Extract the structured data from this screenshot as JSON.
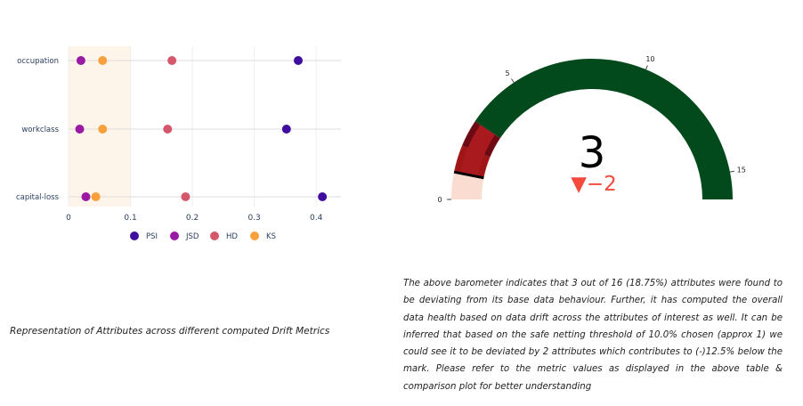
{
  "chart_data": [
    {
      "type": "scatter",
      "categories": [
        "occupation",
        "workclass",
        "capital-loss"
      ],
      "x_ticks": [
        0,
        0.1,
        0.2,
        0.3,
        0.4
      ],
      "x_tick_labels": [
        "0",
        "0.1",
        "0.2",
        "0.3",
        "0.4"
      ],
      "xlim": [
        0,
        0.44
      ],
      "threshold_band": [
        0,
        0.1
      ],
      "band_color": "#fdf4ea",
      "legend_position": "bottom",
      "series": [
        {
          "name": "PSI",
          "color": "#3f0ea0",
          "values": [
            0.371,
            0.352,
            0.41
          ]
        },
        {
          "name": "JSD",
          "color": "#9b1aa3",
          "values": [
            0.02,
            0.018,
            0.028
          ]
        },
        {
          "name": "HD",
          "color": "#d4576b",
          "values": [
            0.167,
            0.16,
            0.189
          ]
        },
        {
          "name": "KS",
          "color": "#f7a03c",
          "values": [
            0.055,
            0.055,
            0.044
          ]
        }
      ]
    },
    {
      "type": "gauge",
      "value": 3,
      "display_value": "3",
      "range": [
        0,
        16
      ],
      "ticks": [
        0,
        5,
        10,
        15
      ],
      "delta": -2,
      "delta_label": "▼−2",
      "bar_color": "#024a1c",
      "steps": [
        {
          "range": [
            0,
            1
          ],
          "color": "#fadcd0"
        },
        {
          "range": [
            1,
            2
          ],
          "color": "#a01616"
        },
        {
          "range": [
            2,
            3
          ],
          "color": "#6e0a14"
        }
      ],
      "bar_band": [
        1,
        3
      ],
      "bar_band_color": "#a81a1e",
      "threshold": 1,
      "delta_color": "#f4493c"
    }
  ],
  "captions": {
    "left": "Representation of Attributes across different computed Drift Metrics",
    "right": "The above barometer indicates that 3 out of 16 (18.75%) attributes were found to be deviating from its base data behaviour. Further, it has computed the overall data health based on data drift across the attributes of interest as well. It can be inferred that based on the safe netting threshold of 10.0% chosen (approx 1) we could see it to be deviated by 2 attributes which contributes to (-)12.5% below the mark. Please refer to the metric values as displayed in the above table & comparison plot for better understanding"
  }
}
